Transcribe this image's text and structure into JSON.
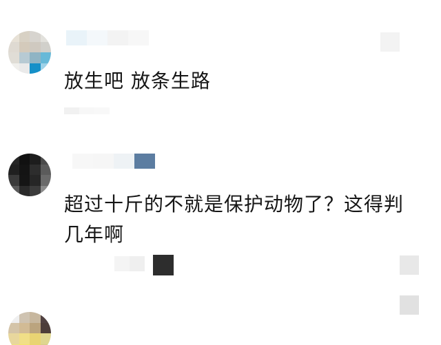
{
  "comments": [
    {
      "text_lines": [
        "放生吧 放条生路"
      ],
      "avatar": {
        "colors": [
          "#e7e1d6",
          "#d8d1c4",
          "#d7d4cf",
          "#e2e1dc",
          "#dfdad2",
          "#d4cabb",
          "#cfc9c0",
          "#d1d0cb",
          "#e0ddd6",
          "#b7cad3",
          "#8fb4c4",
          "#67b9d8",
          "#f0efec",
          "#eaeaea",
          "#1590c8",
          "#9fd2e8"
        ]
      },
      "name_blur_colors": [
        "#e9f3f9",
        "#f4f8fb",
        "#f3f3f3",
        "#f7f7f7"
      ],
      "meta_blur_colors": [
        "#f1f1f1",
        "#f7f7f7",
        "#f8f8f8"
      ]
    },
    {
      "text_lines": [
        "超过十斤的不就是保护动物了？这得判",
        "几年啊"
      ],
      "avatar": {
        "colors": [
          "#262626",
          "#111111",
          "#1d1d1d",
          "#4b4b4b",
          "#202020",
          "#141414",
          "#2d2d2d",
          "#5b5b5b",
          "#3a3a3a",
          "#151515",
          "#262626",
          "#6a6a6a",
          "#5a5a5a",
          "#2a2a2a",
          "#3b3b3b",
          "#8b8b8b"
        ]
      },
      "name_blur_colors": [
        "#f7f7f7",
        "#f6f6f6",
        "#eef2f5",
        "#5c7da1"
      ],
      "meta_blur_colors": [
        "#f4f4f4",
        "#efefef",
        "#2d2d2d"
      ]
    },
    {
      "text_lines": [],
      "avatar": {
        "colors": [
          "#efefef",
          "#cfc3b1",
          "#c7b79e",
          "#504141",
          "#d4c4a8",
          "#d2bb95",
          "#bba47e",
          "#4c3d3a",
          "#e8d79d",
          "#f1df87",
          "#e9d473",
          "#dfd68f",
          "#efe47f",
          "#f4e56d",
          "#ead76a",
          "#d9cc8a"
        ]
      },
      "name_blur_colors": [],
      "meta_blur_colors": []
    }
  ],
  "side_blur_colors": [
    "#f3f3f3",
    "#e8e8e8",
    "#e1e1e1"
  ]
}
